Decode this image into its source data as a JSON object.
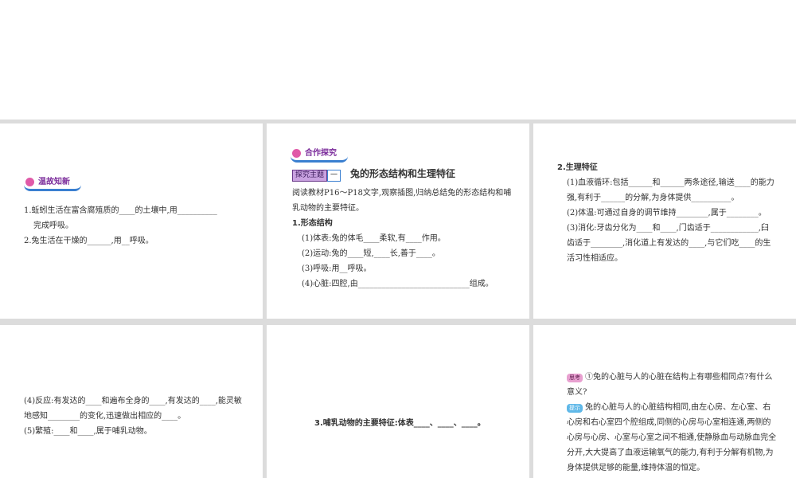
{
  "s1": {
    "badge": "温故知新",
    "lines": [
      "1.蚯蚓生活在富含腐殖质的____的土壤中,用__________",
      "完成呼吸。",
      "2.兔生活在干燥的______,用__呼吸。"
    ]
  },
  "s2": {
    "badge": "合作探究",
    "topic": "探究主题",
    "topic_num": "一",
    "title": "兔的形态结构和生理特征",
    "intro": "阅读教材P16～P18文字,观察插图,归纳总结兔的形态结构和哺乳动物的主要特征。",
    "h": "1.形态结构",
    "items": [
      "(1)体表:兔的体毛____柔软,有____作用。",
      "(2)运动:兔的____短,____长,善于____。",
      "(3)呼吸:用__呼吸。",
      "(4)心脏:四腔,由____________________________组成。"
    ]
  },
  "s3": {
    "h": "2.生理特征",
    "items": [
      "(1)血液循环:包括______和______两条途径,输送____的能力强,有利于______的分解,为身体提供__________。",
      "(2)体温:可通过自身的调节维持________,属于________。",
      "(3)消化:牙齿分化为____和____,门齿适于____________,臼齿适于________,消化道上有发达的____,与它们吃____的生活习性相适应。"
    ]
  },
  "s4": {
    "items": [
      "(4)反应:有发达的____和遍布全身的____,有发达的____,能灵敏地感知________的变化,迅速做出相应的____。",
      "(5)繁殖:____和____,属于哺乳动物。"
    ]
  },
  "s5": {
    "text": "3.哺乳动物的主要特征:体表____、____、____。"
  },
  "s6": {
    "think_tag": "思考",
    "question": "①兔的心脏与人的心脏在结构上有哪些相同点?有什么意义?",
    "hint_tag": "提示",
    "answer": "兔的心脏与人的心脏结构相同,由左心房、左心室、右心房和右心室四个腔组成,同侧的心房与心室相连通,两侧的心房与心房、心室与心室之间不相通,使静脉血与动脉血完全分开,大大提高了血液运输氧气的能力,有利于分解有机物,为身体提供足够的能量,维持体温的恒定。"
  }
}
